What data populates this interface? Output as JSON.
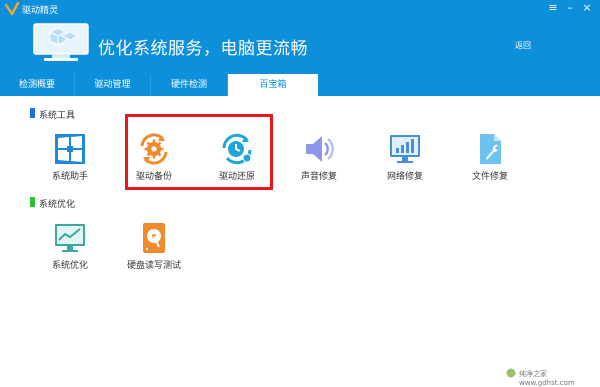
{
  "app": {
    "title": "驱动精灵"
  },
  "banner": {
    "slogan": "优化系统服务，电脑更流畅",
    "back_label": "返回"
  },
  "tabs": [
    {
      "label": "检测概要"
    },
    {
      "label": "驱动管理"
    },
    {
      "label": "硬件检测"
    },
    {
      "label": "百宝箱",
      "active": true
    }
  ],
  "sections": {
    "system_tools": {
      "title": "系统工具",
      "marker_color": "#1e6fe0",
      "items": [
        {
          "label": "系统助手",
          "icon": "windows-tile-icon"
        },
        {
          "label": "驱动备份",
          "icon": "gear-backup-icon"
        },
        {
          "label": "驱动还原",
          "icon": "clock-restore-icon"
        },
        {
          "label": "声音修复",
          "icon": "speaker-icon"
        },
        {
          "label": "网络修复",
          "icon": "network-monitor-icon"
        },
        {
          "label": "文件修复",
          "icon": "file-wrench-icon"
        }
      ]
    },
    "system_optimize": {
      "title": "系统优化",
      "marker_color": "#2bbf3a",
      "items": [
        {
          "label": "系统优化",
          "icon": "trend-monitor-icon"
        },
        {
          "label": "硬盘读写测试",
          "icon": "harddisk-icon"
        }
      ]
    }
  },
  "watermark": {
    "text": "纯净之家 www.gdhst.com"
  },
  "colors": {
    "header_blue": "#0e8fdc",
    "highlight_red": "#e8161e",
    "backup_orange": "#f08a2c",
    "restore_cyan": "#1fa6d8"
  }
}
